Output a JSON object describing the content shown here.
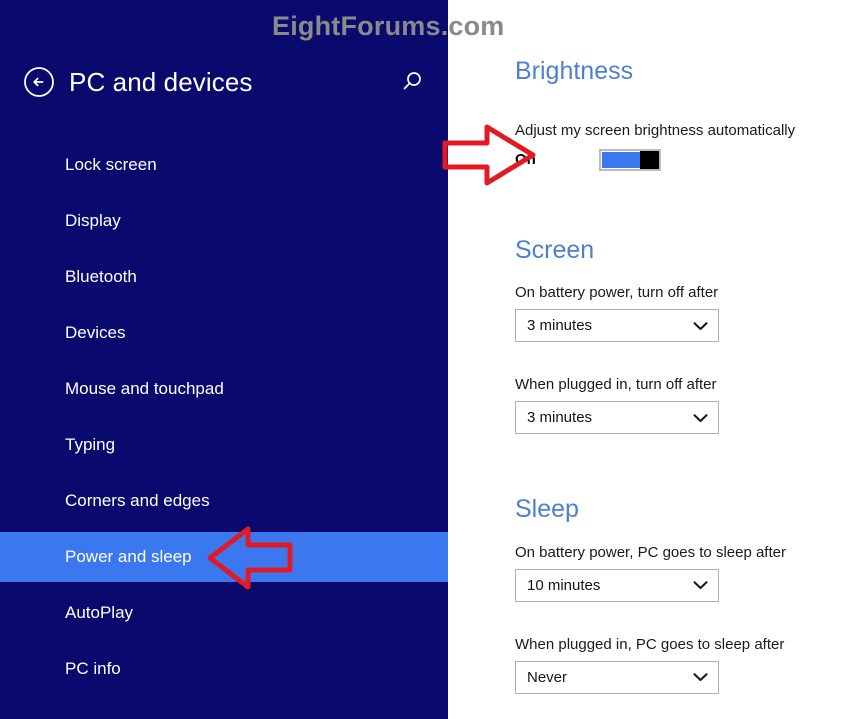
{
  "watermark": {
    "text": "EightForums.com",
    "color": "#8a8a8a"
  },
  "theme": {
    "sidebar_bg": "#0a0a6e",
    "selected_bg": "#3b78f0",
    "heading_color": "#4f7fd0",
    "annotation_color": "#e01b24",
    "toggle_on_color": "#3b78f0",
    "toggle_thumb_color": "#000000"
  },
  "sidebar": {
    "back_icon": "back-arrow-circle-icon",
    "title": "PC and devices",
    "search_icon": "search-icon",
    "items": [
      {
        "label": "Lock screen",
        "selected": false
      },
      {
        "label": "Display",
        "selected": false
      },
      {
        "label": "Bluetooth",
        "selected": false
      },
      {
        "label": "Devices",
        "selected": false
      },
      {
        "label": "Mouse and touchpad",
        "selected": false
      },
      {
        "label": "Typing",
        "selected": false
      },
      {
        "label": "Corners and edges",
        "selected": false
      },
      {
        "label": "Power and sleep",
        "selected": true
      },
      {
        "label": "AutoPlay",
        "selected": false
      },
      {
        "label": "PC info",
        "selected": false
      }
    ]
  },
  "content": {
    "brightness": {
      "heading": "Brightness",
      "auto_label": "Adjust my screen brightness automatically",
      "auto_state": "On",
      "toggle_icon": "toggle-switch-on-icon"
    },
    "screen": {
      "heading": "Screen",
      "battery_label": "On battery power, turn off after",
      "battery_value": "3 minutes",
      "plugged_label": "When plugged in, turn off after",
      "plugged_value": "3 minutes"
    },
    "sleep": {
      "heading": "Sleep",
      "battery_label": "On battery power, PC goes to sleep after",
      "battery_value": "10 minutes",
      "plugged_label": "When plugged in, PC goes to sleep after",
      "plugged_value": "Never"
    },
    "chevron_icon": "chevron-down-icon"
  },
  "annotations": [
    {
      "name": "red-arrow-right",
      "points_to": "On"
    },
    {
      "name": "red-arrow-left",
      "points_to": "Power and sleep"
    }
  ]
}
